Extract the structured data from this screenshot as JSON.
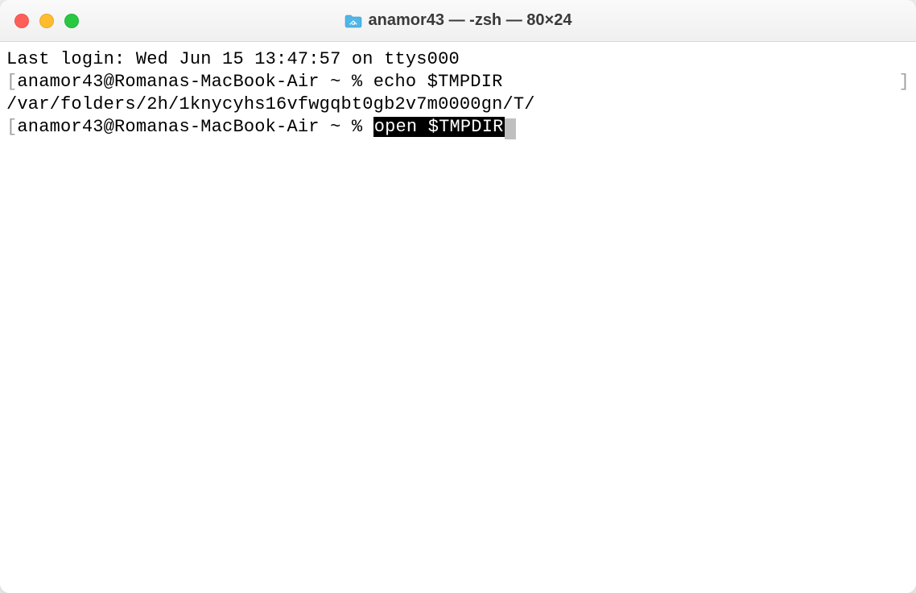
{
  "window": {
    "title": "anamor43 — -zsh — 80×24",
    "folder_icon_name": "home-folder-icon"
  },
  "terminal": {
    "last_login_line": "Last login: Wed Jun 15 13:47:57 on ttys000",
    "prompt1_prefix": "anamor43@Romanas-MacBook-Air ~ % ",
    "command1": "echo $TMPDIR",
    "output1": "/var/folders/2h/1knycyhs16vfwgqbt0gb2v7m0000gn/T/",
    "prompt2_prefix": "anamor43@Romanas-MacBook-Air ~ % ",
    "command2_highlighted": "open $TMPDIR",
    "left_bracket": "[",
    "right_bracket": "]"
  }
}
